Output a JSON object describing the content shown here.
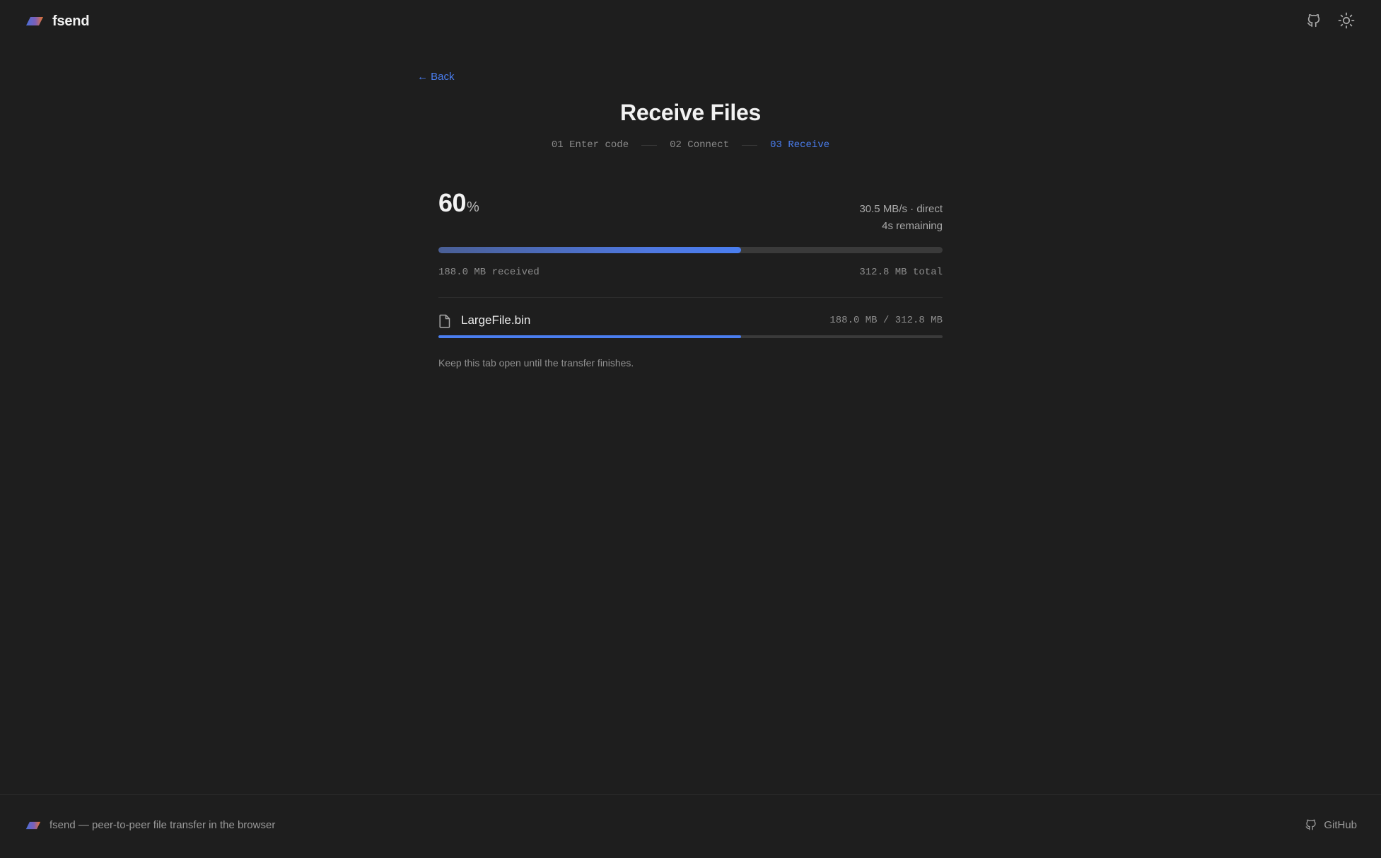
{
  "header": {
    "brand": "fsend",
    "icons": [
      "github-icon",
      "sun-icon"
    ]
  },
  "nav": {
    "back": "← Back"
  },
  "main": {
    "title": "Receive Files",
    "steps": [
      {
        "label": "01 Enter code",
        "active": false
      },
      {
        "label": "02 Connect",
        "active": false
      },
      {
        "label": "03 Receive",
        "active": true
      }
    ]
  },
  "transfer": {
    "percent": "60",
    "percent_sign": "%",
    "progress_fraction": 0.6,
    "rate": "30.5 MB/s · direct",
    "remaining": "4s remaining",
    "received": "188.0 MB received",
    "total": "312.8 MB total",
    "note": "Keep this tab open until the transfer finishes."
  },
  "files": [
    {
      "icon": "file-icon",
      "name": "LargeFile.bin",
      "size": "188.0 MB / 312.8 MB",
      "progress_fraction": 0.6
    }
  ],
  "footer": {
    "tagline": "fsend — peer-to-peer file transfer in the browser",
    "github": "GitHub"
  },
  "colors": {
    "background": "#1e1e1e",
    "accent": "#4a7ef0",
    "logo_orange": "#e8742a",
    "logo_blue": "#4a6fd8"
  }
}
